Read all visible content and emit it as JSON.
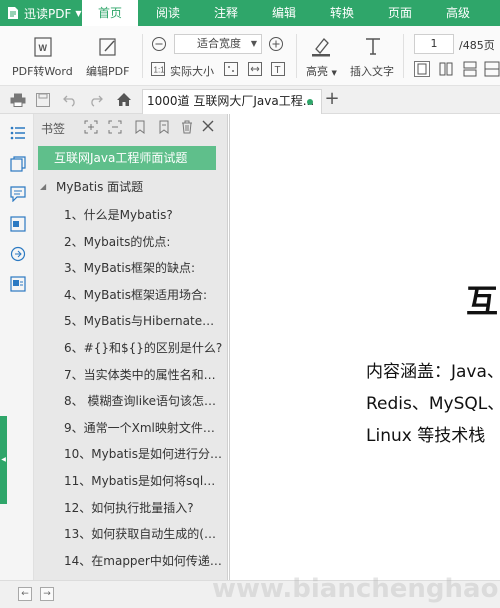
{
  "app": {
    "title": "迅读PDF"
  },
  "menu": {
    "tabs": [
      {
        "label": "首页",
        "active": true
      },
      {
        "label": "阅读",
        "active": false
      },
      {
        "label": "注释",
        "active": false
      },
      {
        "label": "编辑",
        "active": false
      },
      {
        "label": "转换",
        "active": false
      },
      {
        "label": "页面",
        "active": false
      },
      {
        "label": "高级",
        "active": false
      }
    ]
  },
  "ribbon": {
    "pdf_to_word": "PDF转Word",
    "edit_pdf": "编辑PDF",
    "zoom_value": "适合宽度",
    "actual_size": "实际大小",
    "highlight": "高亮",
    "insert_text": "插入文字",
    "page_current": "1",
    "page_total": "/485页"
  },
  "tabbar": {
    "doc_tab_label": "1000道 互联网大厂Java工程..."
  },
  "bookmarks": {
    "panel_title": "书签",
    "root": "互联网Java工程师面试题",
    "group": "MyBatis 面试题",
    "items": [
      "1、什么是Mybatis?",
      "2、Mybaits的优点:",
      "3、MyBatis框架的缺点:",
      "4、MyBatis框架适用场合:",
      "5、MyBatis与Hibernate有哪...",
      "6、#{}和${}的区别是什么?",
      "7、当实体类中的属性名和表...",
      "8、 模糊查询like语句该怎么写?",
      "9、通常一个Xml映射文件，都...",
      "10、Mybatis是如何进行分页...",
      "11、Mybatis是如何将sql执行...",
      "12、如何执行批量插入?",
      "13、如何获取自动生成的(主)...",
      "14、在mapper中如何传递多..."
    ]
  },
  "document": {
    "heading": "互",
    "lines": [
      "内容涵盖：Java、",
      "Redis、MySQL、",
      "Linux  等技术栈"
    ],
    "watermark": "www.bianchenghao.cn"
  },
  "colors": {
    "accent": "#2fa66a",
    "bookmark_selected": "#5fbf8b",
    "panel_bg": "#e8e8e8"
  }
}
